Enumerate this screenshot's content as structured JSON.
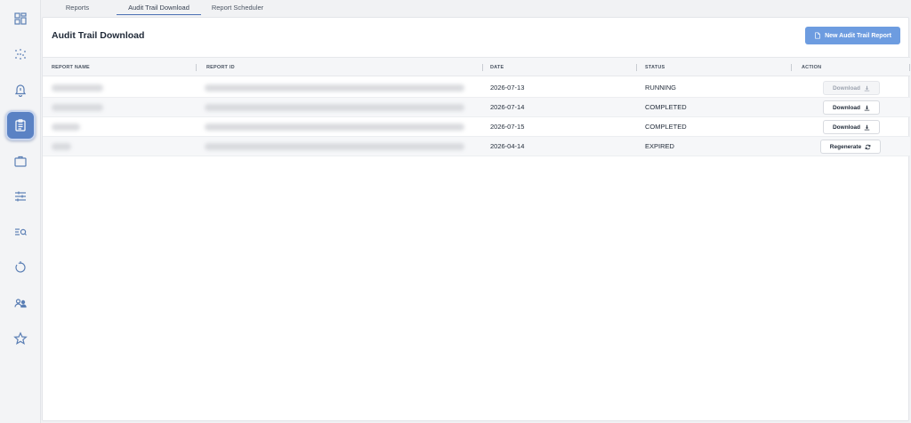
{
  "sidebar": {
    "items": [
      {
        "icon": "dashboard-grid-icon",
        "active": false
      },
      {
        "icon": "network-dots-icon",
        "active": false
      },
      {
        "icon": "bell-alert-icon",
        "active": false
      },
      {
        "icon": "clipboard-report-icon",
        "active": true
      },
      {
        "icon": "briefcase-icon",
        "active": false
      },
      {
        "icon": "sliders-icon",
        "active": false
      },
      {
        "icon": "search-list-icon",
        "active": false
      },
      {
        "icon": "refresh-history-icon",
        "active": false
      },
      {
        "icon": "users-icon",
        "active": false
      },
      {
        "icon": "star-icon",
        "active": false
      }
    ],
    "accent": "#5a82c4"
  },
  "tabs": [
    {
      "label": "Reports",
      "active": false
    },
    {
      "label": "Audit Trail Download",
      "active": true
    },
    {
      "label": "Report Scheduler",
      "active": false
    }
  ],
  "header": {
    "title": "Audit Trail Download",
    "new_button_label": "New Audit Trail Report",
    "new_button_color": "#6d9ce0"
  },
  "table": {
    "columns": [
      "REPORT NAME",
      "REPORT ID",
      "DATE",
      "STATUS",
      "ACTION"
    ],
    "rows": [
      {
        "date": "2026-07-13",
        "status": "RUNNING",
        "action": "Download",
        "action_icon": "download-icon",
        "action_enabled": false
      },
      {
        "date": "2026-07-14",
        "status": "COMPLETED",
        "action": "Download",
        "action_icon": "download-icon",
        "action_enabled": true
      },
      {
        "date": "2026-07-15",
        "status": "COMPLETED",
        "action": "Download",
        "action_icon": "download-icon",
        "action_enabled": true
      },
      {
        "date": "2026-04-14",
        "status": "EXPIRED",
        "action": "Regenerate",
        "action_icon": "refresh-icon",
        "action_enabled": true
      }
    ]
  }
}
